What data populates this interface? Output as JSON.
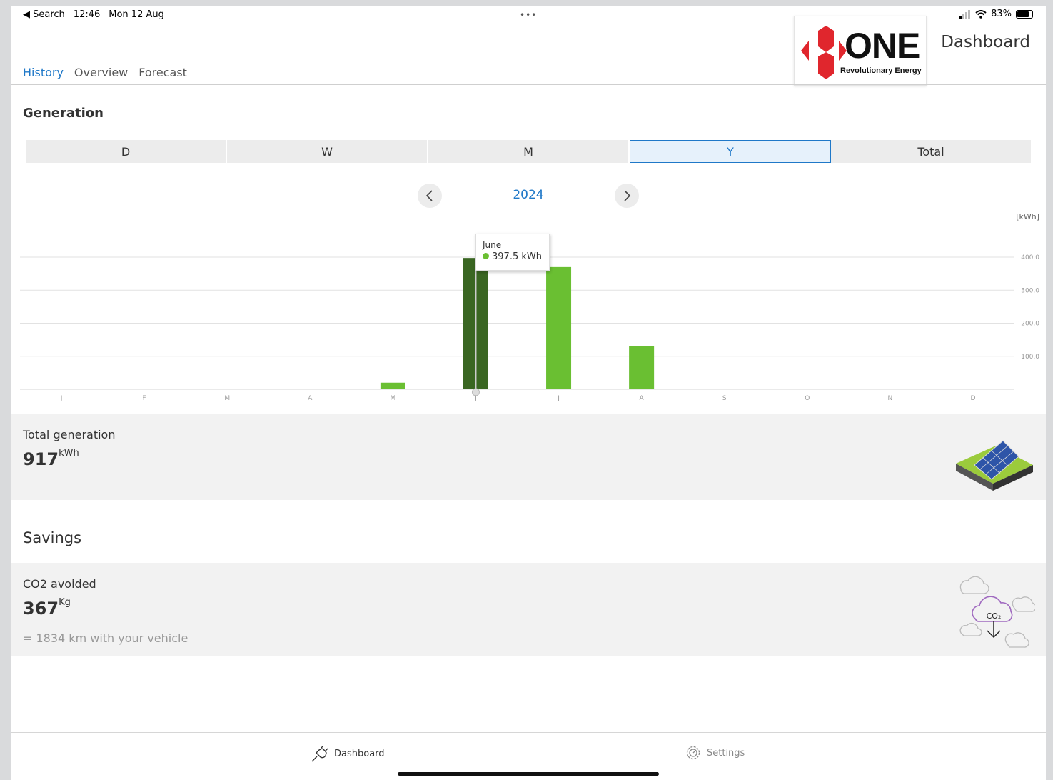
{
  "status_bar": {
    "back_label": "◀ Search",
    "time": "12:46",
    "date": "Mon 12 Aug",
    "battery": "83%",
    "dots": "•••"
  },
  "header": {
    "logo_word": "ONE",
    "logo_tagline": "Revolutionary Energy",
    "title": "Dashboard",
    "tabs": [
      {
        "label": "History",
        "active": true
      },
      {
        "label": "Overview",
        "active": false
      },
      {
        "label": "Forecast",
        "active": false
      }
    ]
  },
  "generation": {
    "title": "Generation",
    "periods": [
      "D",
      "W",
      "M",
      "Y",
      "Total"
    ],
    "active_period": "Y",
    "year": "2024",
    "unit_label": "[kWh]"
  },
  "chart_data": {
    "type": "bar",
    "categories": [
      "J",
      "F",
      "M",
      "A",
      "M",
      "J",
      "J",
      "A",
      "S",
      "O",
      "N",
      "D"
    ],
    "values": [
      0,
      0,
      0,
      0,
      20,
      397.5,
      370,
      130,
      0,
      0,
      0,
      0
    ],
    "ylabel": "[kWh]",
    "yticks": [
      "100.0",
      "200.0",
      "300.0",
      "400.0"
    ],
    "ylim": [
      0,
      400
    ],
    "grid": true,
    "highlight_index": 5,
    "colors": {
      "bar": "#6abf32",
      "highlight": "#3a6622",
      "grid": "#e2e2e2"
    },
    "tooltip": {
      "label": "June",
      "value": "397.5 kWh"
    }
  },
  "total_generation": {
    "label": "Total generation",
    "value": "917",
    "unit": "kWh"
  },
  "savings": {
    "title": "Savings",
    "co2_label": "CO2 avoided",
    "co2_value": "367",
    "co2_unit": "Kg",
    "vehicle_note": "= 1834 km with your vehicle",
    "co2_icon_text": "CO₂"
  },
  "bottom_nav": {
    "dashboard": "Dashboard",
    "settings": "Settings"
  },
  "icons": [
    "back-arrow-icon",
    "signal-icon",
    "wifi-icon",
    "battery-icon",
    "chevron-left-icon",
    "chevron-right-icon",
    "solar-panel-icon",
    "co2-cloud-icon",
    "plug-icon",
    "gear-icon"
  ]
}
